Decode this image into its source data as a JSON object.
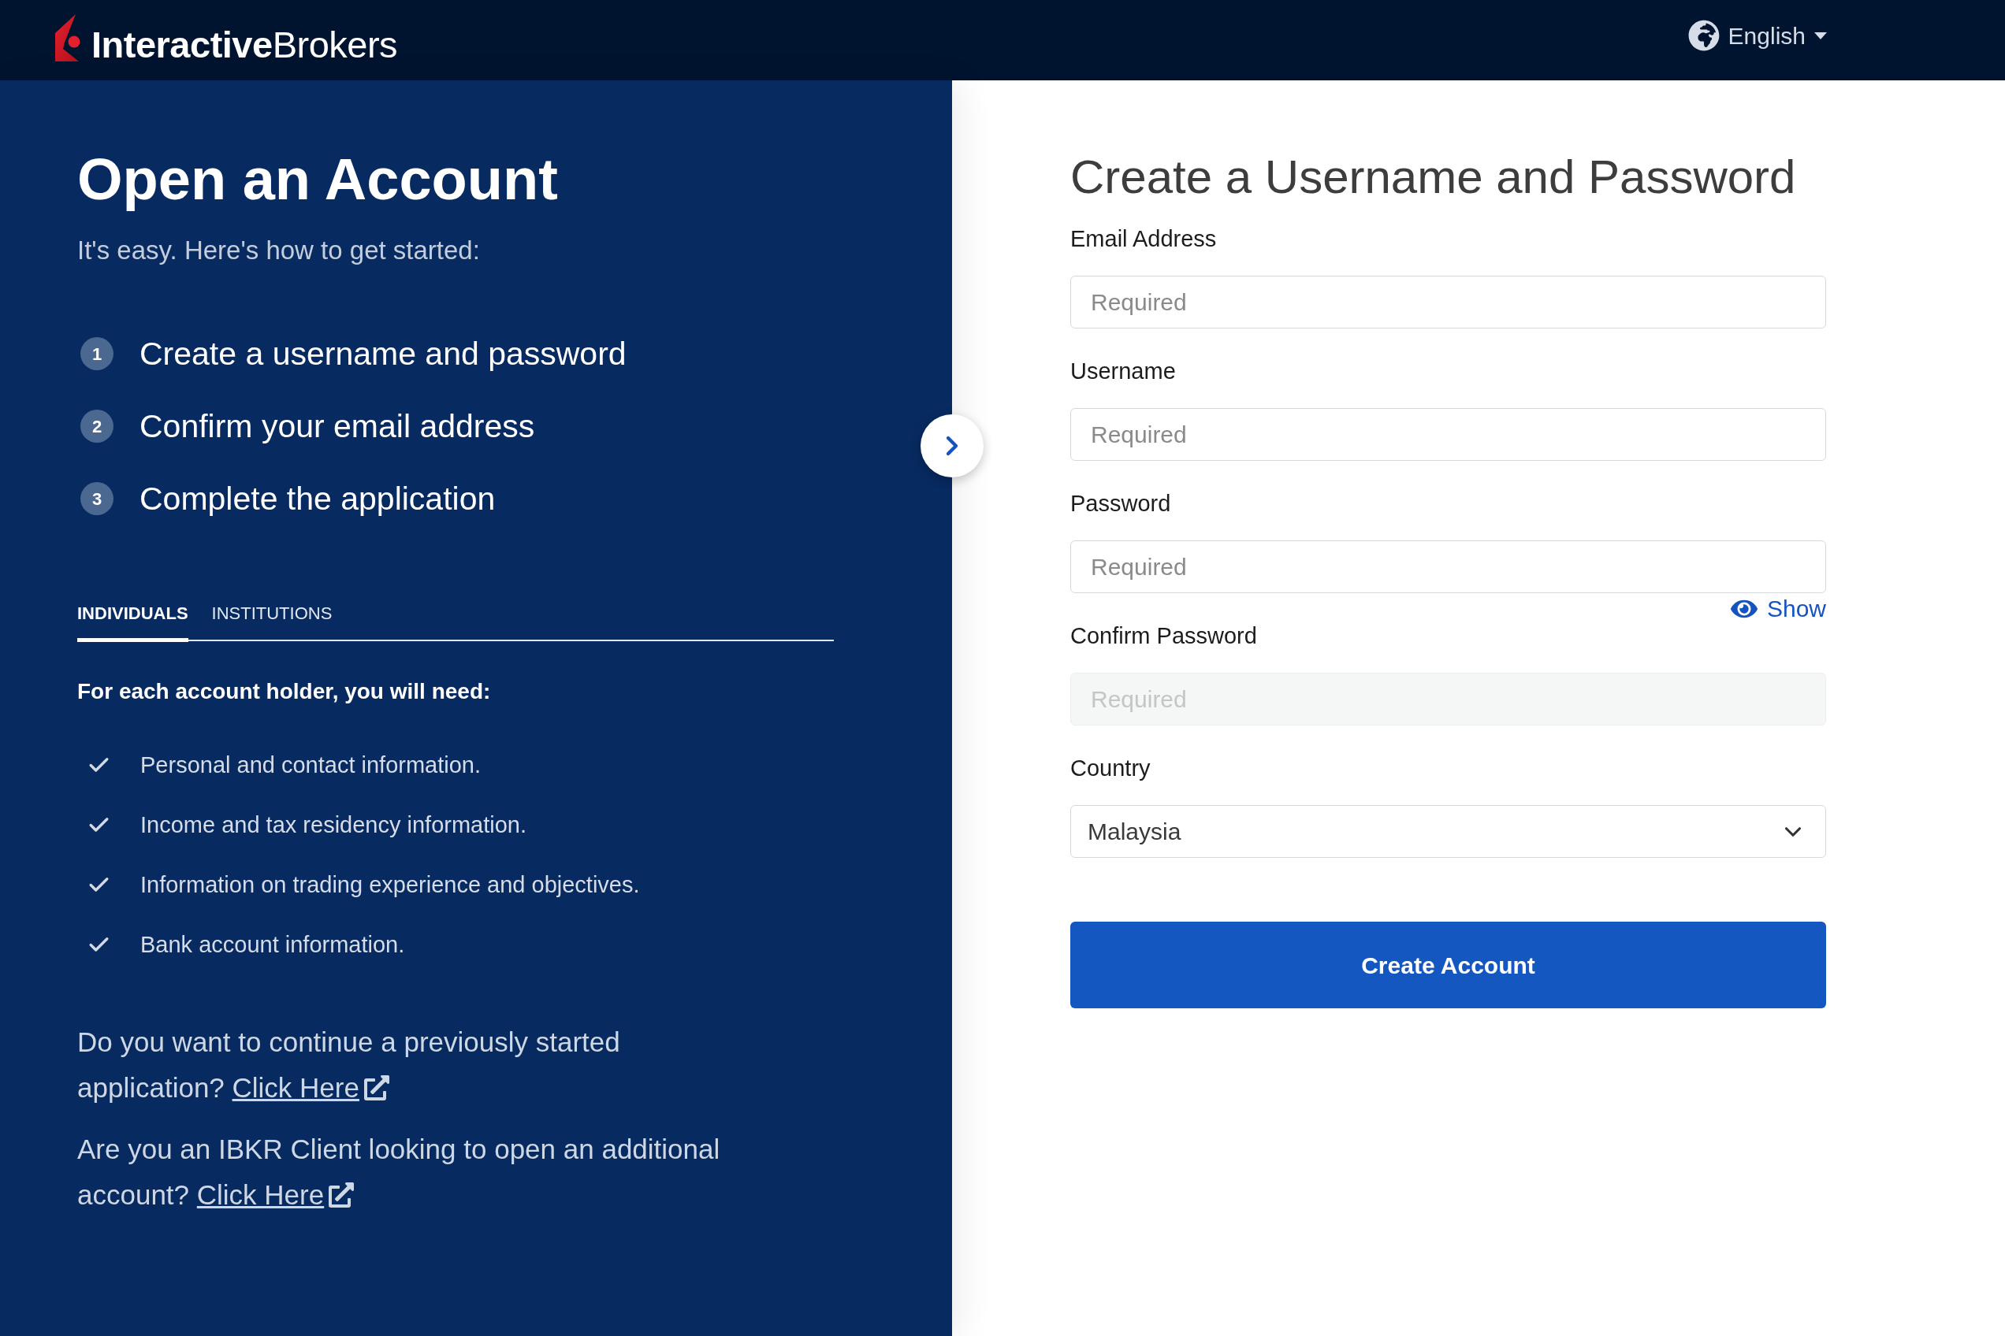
{
  "header": {
    "logo": "**Interactive**Brokers",
    "language": "English"
  },
  "intro": {
    "title": "Open an Account",
    "subtitle": "It's easy. Here's how to get started:",
    "steps": [
      {
        "number": "1",
        "text": "Create a username and password"
      },
      {
        "number": "2",
        "text": "Confirm your email address"
      },
      {
        "number": "3",
        "text": "Complete the application"
      }
    ]
  },
  "tabs": [
    {
      "label": "INDIVIDUALS",
      "selected": true
    },
    {
      "label": "INSTITUTIONS",
      "selected": false
    }
  ],
  "requirements": {
    "heading": "For each account holder, you will need:",
    "items": [
      "Personal and contact information.",
      "Income and tax residency information.",
      "Information on trading experience and objectives.",
      "Bank account information."
    ]
  },
  "prompts": [
    {
      "text": "Do you want to continue a previously started application?",
      "link": "Click Here"
    },
    {
      "text": "Are you an IBKR Client looking to open an additional account?",
      "link": "Click Here"
    }
  ],
  "form": {
    "title": "Create a Username and Password",
    "fields": [
      {
        "kind": "text",
        "label": "Email Address",
        "placeholder": "Required",
        "disabled": false
      },
      {
        "kind": "text",
        "label": "Username",
        "placeholder": "Required",
        "disabled": false
      },
      {
        "kind": "password",
        "label": "Password",
        "placeholder": "Required",
        "disabled": false,
        "toggle": "Show"
      },
      {
        "kind": "password",
        "label": "Confirm Password",
        "placeholder": "Required",
        "disabled": true
      },
      {
        "kind": "select",
        "label": "Country",
        "value": "Malaysia",
        "disabled": false
      }
    ],
    "submit": "Create Account"
  }
}
